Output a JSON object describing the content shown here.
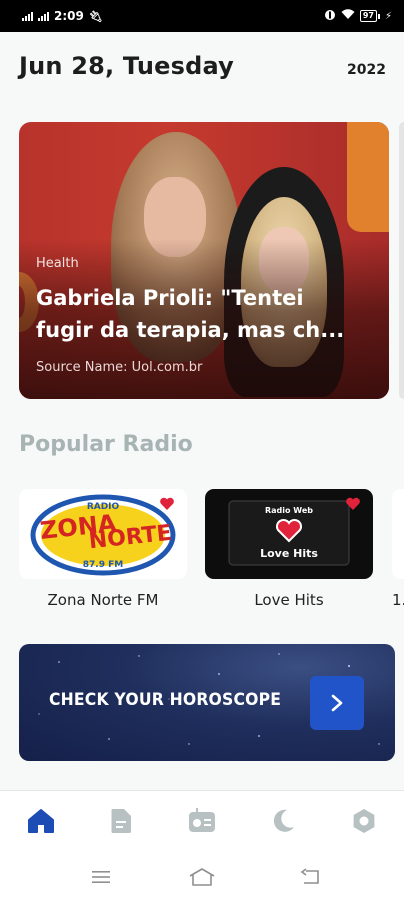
{
  "status_bar": {
    "time": "2:09",
    "battery": "97"
  },
  "header": {
    "date": "Jun 28, Tuesday",
    "year": "2022"
  },
  "featured_news": {
    "category": "Health",
    "title_line1": "Gabriela Prioli: \"Tentei",
    "title_line2": "fugir da terapia, mas ch...",
    "source": "Source Name: Uol.com.br"
  },
  "popular_radio": {
    "title": "Popular Radio",
    "stations": [
      {
        "name": "Zona Norte FM",
        "logo_top": "RADIO",
        "logo_line1": "ZONA",
        "logo_line2": "NORTE",
        "logo_freq": "87.9 FM"
      },
      {
        "name": "Love Hits",
        "logo_top": "Radio Web",
        "logo_main": "Love Hits"
      },
      {
        "name": "1."
      }
    ]
  },
  "horoscope_banner": {
    "text": "CHECK YOUR HOROSCOPE"
  },
  "bottom_nav": {
    "items": [
      {
        "icon": "home-icon",
        "active": true
      },
      {
        "icon": "document-icon",
        "active": false
      },
      {
        "icon": "radio-icon",
        "active": false
      },
      {
        "icon": "moon-icon",
        "active": false
      },
      {
        "icon": "settings-icon",
        "active": false
      }
    ]
  },
  "colors": {
    "accent": "#1d4cb5",
    "inactive_icon": "#b7c1c1",
    "section_title": "#a8b4b4",
    "news_card": "#c53a2e"
  }
}
